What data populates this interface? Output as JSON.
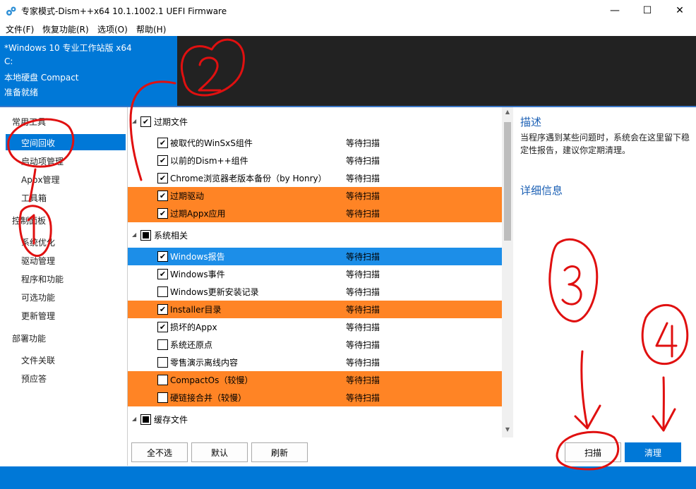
{
  "window": {
    "title": "专家模式-Dism++x64 10.1.1002.1 UEFI Firmware",
    "min_glyph": "—",
    "max_glyph": "☐",
    "close_glyph": "✕"
  },
  "menu": [
    "文件(F)",
    "恢复功能(R)",
    "选项(O)",
    "帮助(H)"
  ],
  "header": {
    "os": "*Windows 10 专业工作站版 x64",
    "drive": "C:",
    "disk": "本地硬盘 Compact",
    "status": "准备就绪"
  },
  "sidebar": {
    "groups": [
      {
        "title": "常用工具",
        "items": [
          "空间回收",
          "启动项管理",
          "Appx管理",
          "工具箱"
        ]
      },
      {
        "title": "控制面板",
        "items": [
          "系统优化",
          "驱动管理",
          "程序和功能",
          "可选功能",
          "更新管理"
        ]
      },
      {
        "title": "部署功能",
        "items": [
          "文件关联",
          "预应答"
        ]
      }
    ],
    "selected": "空间回收"
  },
  "list": {
    "groups": [
      {
        "title": "过期文件",
        "checked": true,
        "rows": [
          {
            "label": "被取代的WinSxS组件",
            "status": "等待扫描",
            "checked": true,
            "highlight": "none"
          },
          {
            "label": "以前的Dism++组件",
            "status": "等待扫描",
            "checked": true,
            "highlight": "none"
          },
          {
            "label": "Chrome浏览器老版本备份（by Honry）",
            "status": "等待扫描",
            "checked": true,
            "highlight": "none"
          },
          {
            "label": "过期驱动",
            "status": "等待扫描",
            "checked": true,
            "highlight": "orange"
          },
          {
            "label": "过期Appx应用",
            "status": "等待扫描",
            "checked": true,
            "highlight": "orange"
          }
        ]
      },
      {
        "title": "系统相关",
        "checked": false,
        "rows": [
          {
            "label": "Windows报告",
            "status": "等待扫描",
            "checked": true,
            "highlight": "blue"
          },
          {
            "label": "Windows事件",
            "status": "等待扫描",
            "checked": true,
            "highlight": "none"
          },
          {
            "label": "Windows更新安装记录",
            "status": "等待扫描",
            "checked": false,
            "highlight": "none"
          },
          {
            "label": "Installer目录",
            "status": "等待扫描",
            "checked": true,
            "highlight": "orange"
          },
          {
            "label": "损坏的Appx",
            "status": "等待扫描",
            "checked": true,
            "highlight": "none"
          },
          {
            "label": "系统还原点",
            "status": "等待扫描",
            "checked": false,
            "highlight": "none"
          },
          {
            "label": "零售演示离线内容",
            "status": "等待扫描",
            "checked": false,
            "highlight": "none"
          },
          {
            "label": "CompactOs（较慢）",
            "status": "等待扫描",
            "checked": false,
            "highlight": "orange"
          },
          {
            "label": "硬链接合并（较慢）",
            "status": "等待扫描",
            "checked": false,
            "highlight": "orange"
          }
        ]
      },
      {
        "title": "缓存文件",
        "checked": false,
        "rows": []
      }
    ],
    "buttons": {
      "none": "全不选",
      "default": "默认",
      "refresh": "刷新"
    }
  },
  "right": {
    "desc_title": "描述",
    "desc_text": "当程序遇到某些问题时，系统会在这里留下稳定性报告，建议你定期清理。",
    "detail_title": "详细信息",
    "scan": "扫描",
    "clean": "清理"
  },
  "annotations": [
    "1",
    "2",
    "3",
    "4"
  ],
  "colors": {
    "accent": "#0078d7",
    "orange_highlight": "#ff8425",
    "annotation_red": "#e01010"
  }
}
